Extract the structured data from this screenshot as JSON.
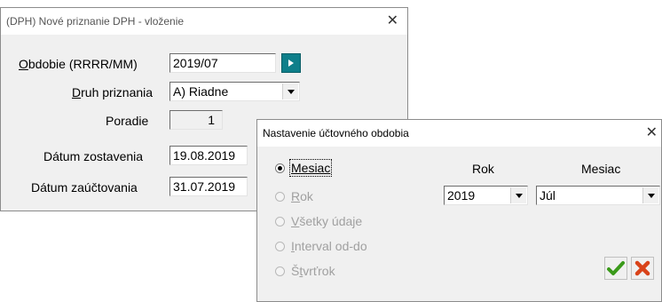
{
  "dialog_vat": {
    "title": "(DPH) Nové priznanie DPH - vloženie",
    "close_glyph": "✕",
    "period": {
      "label_accel": "O",
      "label_rest": "bdobie (RRRR/MM)",
      "value": "2019/07"
    },
    "type": {
      "label_pre": "",
      "label_accel": "D",
      "label_rest": "ruh priznania",
      "value": "A) Riadne"
    },
    "order": {
      "label": "Poradie",
      "value": "1"
    },
    "created": {
      "label": "Dátum zostavenia",
      "value": "19.08.2019"
    },
    "posted": {
      "label": "Dátum zaúčtovania",
      "value": "31.07.2019"
    }
  },
  "dialog_period": {
    "title": "Nastavenie účtovného obdobia",
    "close_glyph": "✕",
    "options": {
      "month": "Mesiac",
      "year_accel": "R",
      "year_rest": "ok",
      "all_accel": "V",
      "all_rest": "šetky údaje",
      "interval_accel": "I",
      "interval_rest": "nterval od-do",
      "quarter_pre": "Š",
      "quarter_accel": "t",
      "quarter_rest": "vrťrok"
    },
    "col_year": "Rok",
    "col_month": "Mesiac",
    "year_value": "2019",
    "month_value": "Júl"
  },
  "colors": {
    "accent": "#0e7f8a",
    "ok": "#3a9a1a",
    "cancel": "#d9431a"
  },
  "icons": {
    "go": "play-icon",
    "ok": "checkmark-icon",
    "cancel": "cross-icon"
  }
}
